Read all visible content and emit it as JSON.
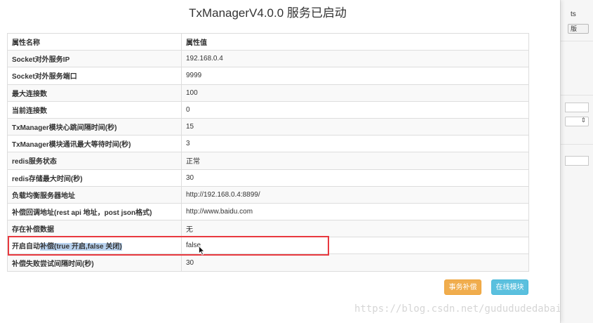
{
  "title": "TxManagerV4.0.0 服务已启动",
  "table": {
    "headers": [
      "属性名称",
      "属性值"
    ],
    "rows": [
      {
        "name": "Socket对外服务IP",
        "value": "192.168.0.4"
      },
      {
        "name": "Socket对外服务端口",
        "value": "9999"
      },
      {
        "name": "最大连接数",
        "value": "100"
      },
      {
        "name": "当前连接数",
        "value": "0"
      },
      {
        "name": "TxManager模块心跳间隔时间(秒)",
        "value": "15"
      },
      {
        "name": "TxManager模块通讯最大等待时间(秒)",
        "value": "3"
      },
      {
        "name": "redis服务状态",
        "value": "正常"
      },
      {
        "name": "redis存储最大时间(秒)",
        "value": "30"
      },
      {
        "name": "负载均衡服务器地址",
        "value": "http://192.168.0.4:8899/"
      },
      {
        "name": "补偿回调地址(rest api 地址，post json格式)",
        "value": "http://www.baidu.com"
      },
      {
        "name": "存在补偿数据",
        "value": "无"
      },
      {
        "name_prefix": "开启自动",
        "name_highlight": "补偿(true 开启,false 关闭)",
        "value": "false"
      },
      {
        "name": "补偿失败尝试间隔时间(秒)",
        "value": "30"
      }
    ]
  },
  "buttons": {
    "compensate": "事务补偿",
    "online_modules": "在线模块"
  },
  "background_app": {
    "text_fragment": "ts",
    "button_fragment": "版"
  },
  "watermark": "https://blog.csdn.net/gudududedabai",
  "colors": {
    "highlight_border": "#e8393f",
    "selection": "#b9d3f0",
    "btn_orange": "#f0ad4e",
    "btn_blue": "#5bc0de"
  }
}
